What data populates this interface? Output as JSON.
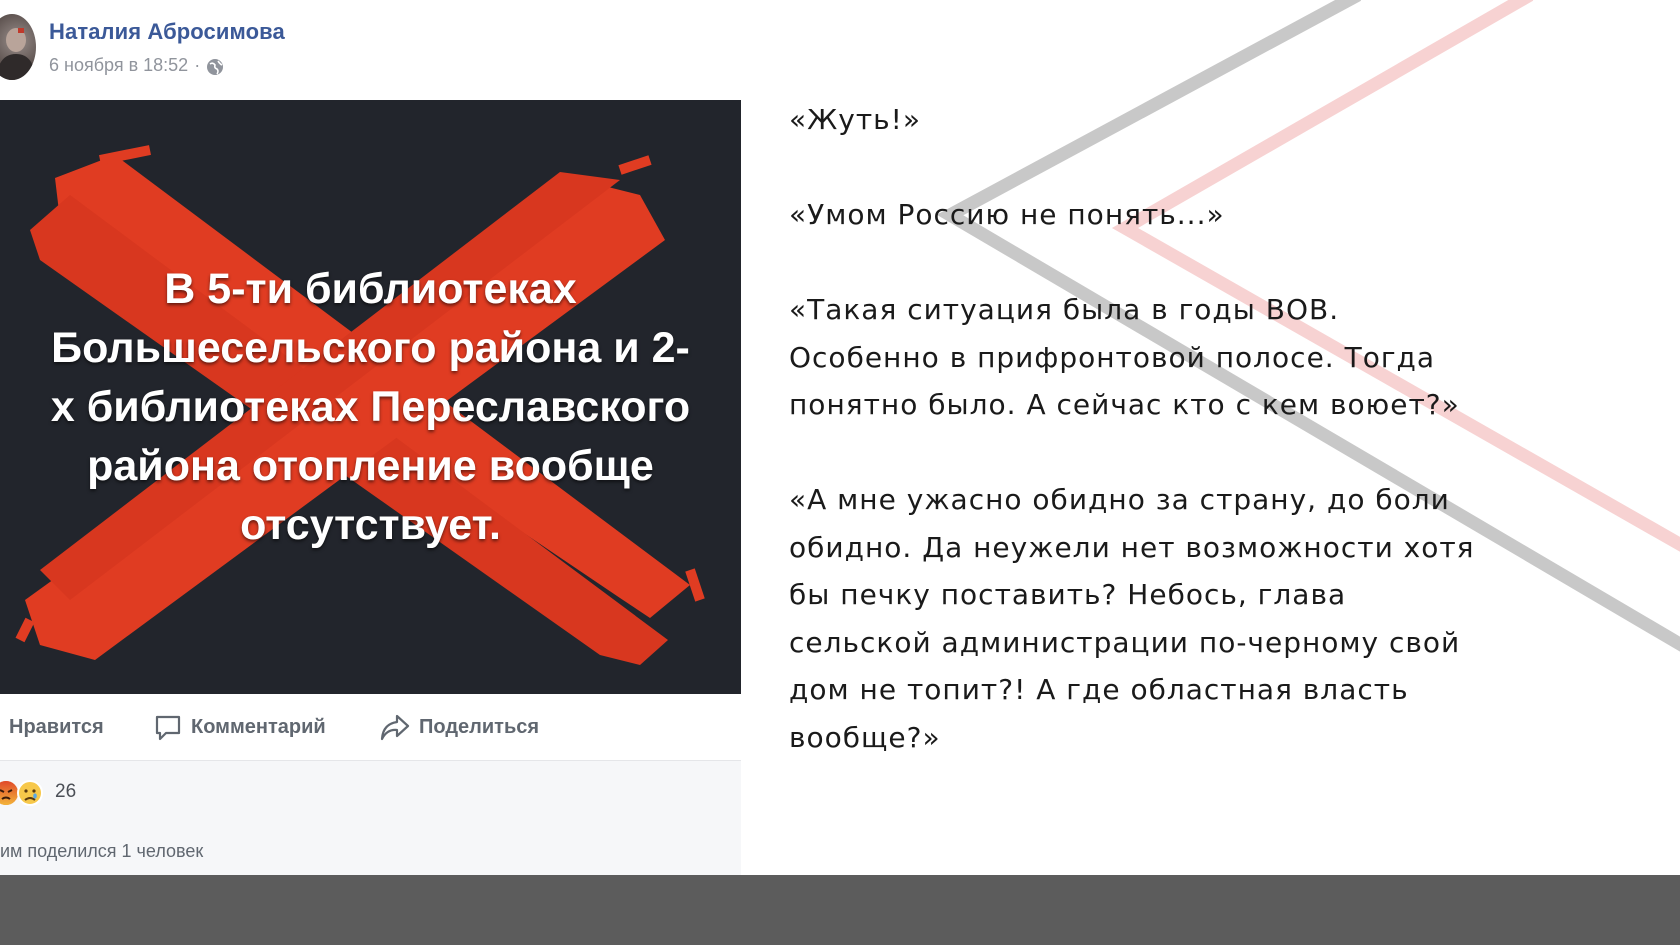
{
  "post": {
    "author": "Наталия Абросимова",
    "timestamp": "6 ноября в 18:52",
    "separator": "·",
    "image_text": [
      "В 5-ти библиотеках",
      "Большесельского района и 2-",
      "х библиотеках Переславского",
      "района отопление вообще",
      "отсутствует."
    ],
    "actions": {
      "like": "Нравится",
      "comment": "Комментарий",
      "share": "Поделиться"
    },
    "reactions_count": "26",
    "shares_text": "им поделился 1 человек"
  },
  "quotes": [
    "«Жуть!»",
    "«Умом Россию не понять...»",
    "«Такая ситуация была в годы ВОВ. Особенно в прифронтовой полосе. Тогда понятно было. А сейчас кто с кем воюет?»",
    "«А мне ужасно обидно за страну, до боли обидно. Да неужели нет возможности хотя бы печку поставить? Небось, глава сельской администрации по-черному свой дом не топит?! А где областная власть вообще?»"
  ],
  "colors": {
    "author_link": "#3b5998",
    "image_bg": "#22252c",
    "cross_red": "#e03c22",
    "footer_band": "#5c5c5c",
    "deco_gray": "#c8c8c8",
    "deco_pink": "#f7cfcf"
  },
  "icons": [
    "globe-icon",
    "comment-icon",
    "share-icon",
    "angry-reaction-icon",
    "sad-reaction-icon"
  ]
}
